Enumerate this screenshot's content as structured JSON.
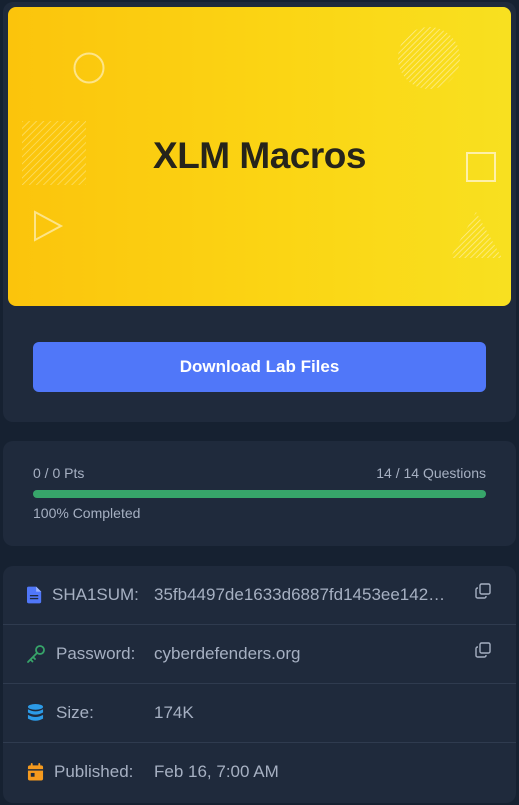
{
  "banner": {
    "title": "XLM Macros"
  },
  "download_button": {
    "label": "Download Lab Files"
  },
  "progress": {
    "points": "0 / 0 Pts",
    "questions": "14 / 14 Questions",
    "completed_text": "100% Completed",
    "completed_fraction": 1.0,
    "bar_color": "#37a56a"
  },
  "info": {
    "sha1": {
      "label": "SHA1SUM:",
      "value": "35fb4497de1633d6887fd1453ee142…",
      "icon": "file-icon"
    },
    "password": {
      "label": "Password:",
      "value": "cyberdefenders.org",
      "icon": "key-icon"
    },
    "size": {
      "label": "Size:",
      "value": "174K",
      "icon": "database-icon"
    },
    "published": {
      "label": "Published:",
      "value": "Feb 16, 7:00 AM",
      "icon": "calendar-icon"
    }
  },
  "colors": {
    "background": "#162131",
    "card": "#1f2a3c",
    "accent": "#5077f9",
    "banner_yellow": "#fbc40c"
  }
}
